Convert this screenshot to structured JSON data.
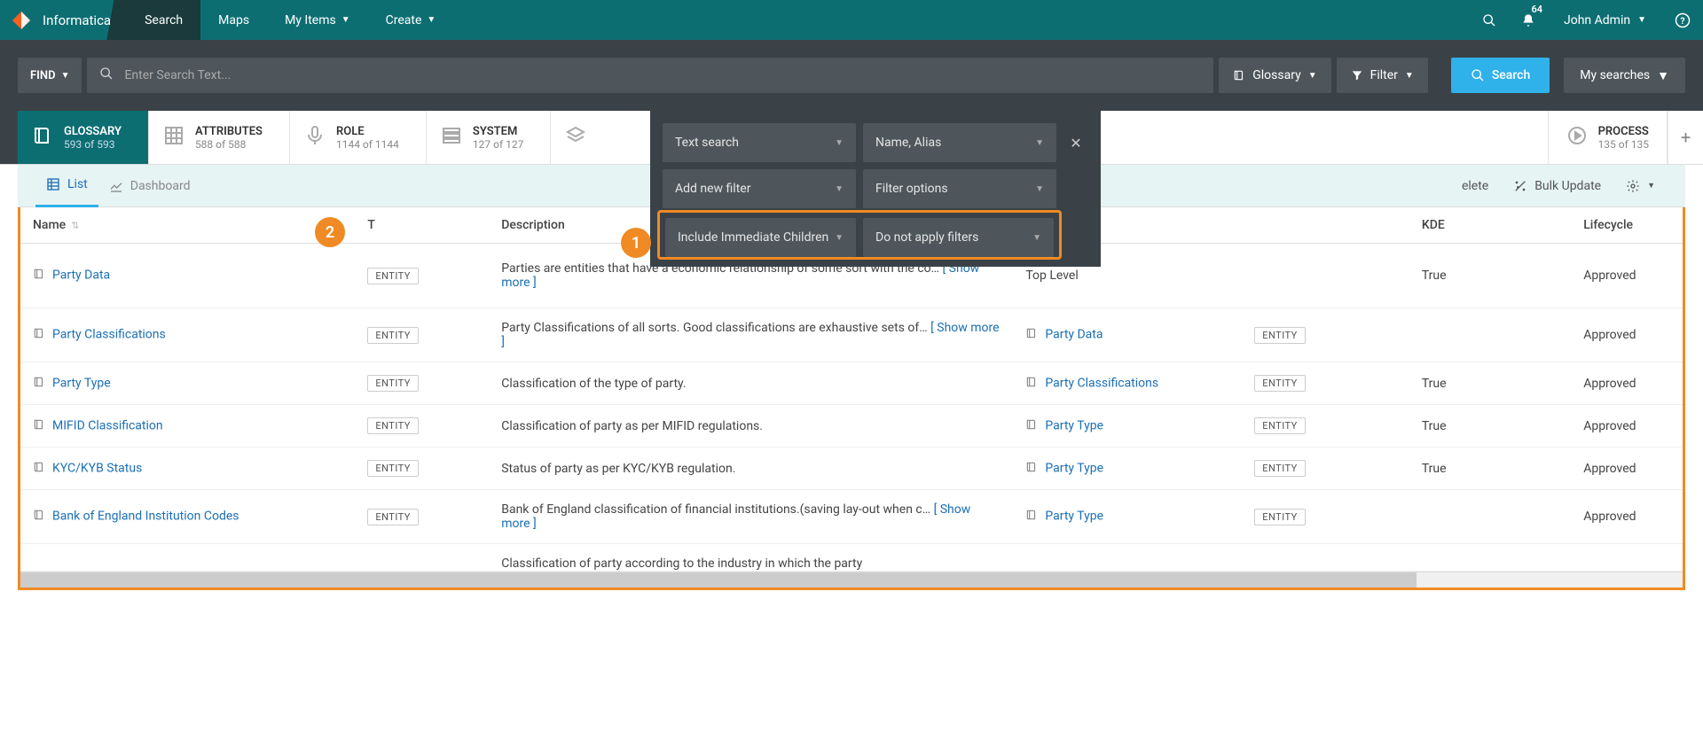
{
  "brand": "Informatica",
  "nav": {
    "search": "Search",
    "maps": "Maps",
    "myitems": "My Items",
    "create": "Create"
  },
  "notifications": "64",
  "user": "John Admin",
  "searchbar": {
    "find": "FIND",
    "placeholder": "Enter Search Text...",
    "glossary": "Glossary",
    "filter": "Filter",
    "search": "Search",
    "mysearches": "My searches"
  },
  "cats": {
    "glossary": {
      "title": "GLOSSARY",
      "count": "593 of 593"
    },
    "attributes": {
      "title": "ATTRIBUTES",
      "count": "588 of 588"
    },
    "role": {
      "title": "ROLE",
      "count": "1144 of 1144"
    },
    "system": {
      "title": "SYSTEM",
      "count": "127 of 127"
    },
    "process": {
      "title": "PROCESS",
      "count": "135 of 135"
    }
  },
  "filters": {
    "textsearch": "Text search",
    "namealias": "Name, Alias",
    "addnew": "Add new filter",
    "options": "Filter options",
    "children": "Include Immediate Children",
    "apply": "Do not apply filters"
  },
  "markers": {
    "one": "1",
    "two": "2"
  },
  "views": {
    "list": "List",
    "dashboard": "Dashboard"
  },
  "actions": {
    "delete": "elete",
    "bulkupdate": "Bulk Update"
  },
  "cols": {
    "name": "Name",
    "type": "T",
    "description": "Description",
    "kde": "KDE",
    "lifecycle": "Lifecycle"
  },
  "badge": "ENTITY",
  "rows": [
    {
      "name": "Party Data",
      "desc": "Parties are entities that have a economic relationship of some sort with the co…",
      "showmore": true,
      "parent_text": "Top Level",
      "parent_link": false,
      "parent_badge": false,
      "kde": "True",
      "life": "Approved"
    },
    {
      "name": "Party Classifications",
      "desc": "Party Classifications of all sorts. Good classifications are exhaustive sets of…",
      "showmore": true,
      "parent_text": "Party Data",
      "parent_link": true,
      "parent_badge": true,
      "kde": "",
      "life": "Approved"
    },
    {
      "name": "Party Type",
      "desc": "Classification of the type of party.",
      "showmore": false,
      "parent_text": "Party Classifications",
      "parent_link": true,
      "parent_badge": true,
      "kde": "True",
      "life": "Approved"
    },
    {
      "name": "MIFID Classification",
      "desc": "Classification of party as per MIFID regulations.",
      "showmore": false,
      "parent_text": "Party Type",
      "parent_link": true,
      "parent_badge": true,
      "kde": "True",
      "life": "Approved"
    },
    {
      "name": "KYC/KYB Status",
      "desc": "Status of party as per KYC/KYB regulation.",
      "showmore": false,
      "parent_text": "Party Type",
      "parent_link": true,
      "parent_badge": true,
      "kde": "True",
      "life": "Approved"
    },
    {
      "name": "Bank of England Institution Codes",
      "desc": "Bank of England classification of financial institutions.(saving lay-out when c…",
      "showmore": true,
      "parent_text": "Party Type",
      "parent_link": true,
      "parent_badge": true,
      "kde": "",
      "life": "Approved"
    }
  ],
  "partial_row_desc": "Classification of party according to the industry in which the party",
  "show_more_label": "[ Show more ]"
}
